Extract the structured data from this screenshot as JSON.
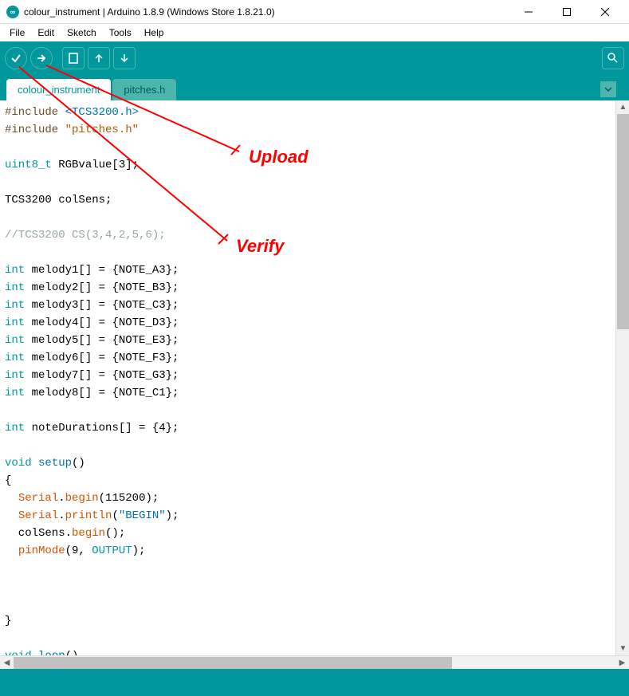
{
  "titlebar": {
    "title": "colour_instrument | Arduino 1.8.9 (Windows Store 1.8.21.0)",
    "icon_text": "∞"
  },
  "menubar": {
    "items": [
      "File",
      "Edit",
      "Sketch",
      "Tools",
      "Help"
    ]
  },
  "toolbar": {
    "verify_name": "verify",
    "upload_name": "upload",
    "new_name": "new",
    "open_name": "open",
    "save_name": "save",
    "serial_name": "serial-monitor"
  },
  "tabs": {
    "items": [
      {
        "label": "colour_instrument",
        "active": true
      },
      {
        "label": "pitches.h",
        "active": false
      }
    ]
  },
  "annotations": {
    "upload": "Upload",
    "verify": "Verify"
  },
  "code": {
    "lines": [
      {
        "t": "pp",
        "txt": "#include"
      },
      {
        "t": "sp"
      },
      {
        "t": "str",
        "txt": "<TCS3200.h>"
      },
      {
        "t": "nl"
      },
      {
        "t": "pp",
        "txt": "#include"
      },
      {
        "t": "sp"
      },
      {
        "t": "str2",
        "txt": "\"pitches.h\""
      },
      {
        "t": "nl"
      },
      {
        "t": "nl"
      },
      {
        "t": "ty",
        "txt": "uint8_t"
      },
      {
        "t": "sp"
      },
      {
        "t": "lit",
        "txt": "RGBvalue[3];"
      },
      {
        "t": "nl"
      },
      {
        "t": "nl"
      },
      {
        "t": "lit",
        "txt": "TCS3200 colSens;"
      },
      {
        "t": "nl"
      },
      {
        "t": "nl"
      },
      {
        "t": "cmt",
        "txt": "//TCS3200 CS(3,4,2,5,6);"
      },
      {
        "t": "nl"
      },
      {
        "t": "nl"
      },
      {
        "t": "ty",
        "txt": "int"
      },
      {
        "t": "sp"
      },
      {
        "t": "lit",
        "txt": "melody1[] = {NOTE_A3};"
      },
      {
        "t": "nl"
      },
      {
        "t": "ty",
        "txt": "int"
      },
      {
        "t": "sp"
      },
      {
        "t": "lit",
        "txt": "melody2[] = {NOTE_B3};"
      },
      {
        "t": "nl"
      },
      {
        "t": "ty",
        "txt": "int"
      },
      {
        "t": "sp"
      },
      {
        "t": "lit",
        "txt": "melody3[] = {NOTE_C3};"
      },
      {
        "t": "nl"
      },
      {
        "t": "ty",
        "txt": "int"
      },
      {
        "t": "sp"
      },
      {
        "t": "lit",
        "txt": "melody4[] = {NOTE_D3};"
      },
      {
        "t": "nl"
      },
      {
        "t": "ty",
        "txt": "int"
      },
      {
        "t": "sp"
      },
      {
        "t": "lit",
        "txt": "melody5[] = {NOTE_E3};"
      },
      {
        "t": "nl"
      },
      {
        "t": "ty",
        "txt": "int"
      },
      {
        "t": "sp"
      },
      {
        "t": "lit",
        "txt": "melody6[] = {NOTE_F3};"
      },
      {
        "t": "nl"
      },
      {
        "t": "ty",
        "txt": "int"
      },
      {
        "t": "sp"
      },
      {
        "t": "lit",
        "txt": "melody7[] = {NOTE_G3};"
      },
      {
        "t": "nl"
      },
      {
        "t": "ty",
        "txt": "int"
      },
      {
        "t": "sp"
      },
      {
        "t": "lit",
        "txt": "melody8[] = {NOTE_C1};"
      },
      {
        "t": "nl"
      },
      {
        "t": "nl"
      },
      {
        "t": "ty",
        "txt": "int"
      },
      {
        "t": "sp"
      },
      {
        "t": "lit",
        "txt": "noteDurations[] = {4};"
      },
      {
        "t": "nl"
      },
      {
        "t": "nl"
      },
      {
        "t": "ty",
        "txt": "void"
      },
      {
        "t": "sp"
      },
      {
        "t": "kw",
        "txt": "setup"
      },
      {
        "t": "lit",
        "txt": "()"
      },
      {
        "t": "nl"
      },
      {
        "t": "lit",
        "txt": "{"
      },
      {
        "t": "nl"
      },
      {
        "t": "lit",
        "txt": "  "
      },
      {
        "t": "fn",
        "txt": "Serial"
      },
      {
        "t": "lit",
        "txt": "."
      },
      {
        "t": "fn",
        "txt": "begin"
      },
      {
        "t": "lit",
        "txt": "(115200);"
      },
      {
        "t": "nl"
      },
      {
        "t": "lit",
        "txt": "  "
      },
      {
        "t": "fn",
        "txt": "Serial"
      },
      {
        "t": "lit",
        "txt": "."
      },
      {
        "t": "fn",
        "txt": "println"
      },
      {
        "t": "lit",
        "txt": "("
      },
      {
        "t": "str",
        "txt": "\"BEGIN\""
      },
      {
        "t": "lit",
        "txt": ");"
      },
      {
        "t": "nl"
      },
      {
        "t": "lit",
        "txt": "  colSens."
      },
      {
        "t": "fn",
        "txt": "begin"
      },
      {
        "t": "lit",
        "txt": "();"
      },
      {
        "t": "nl"
      },
      {
        "t": "lit",
        "txt": "  "
      },
      {
        "t": "fn",
        "txt": "pinMode"
      },
      {
        "t": "lit",
        "txt": "(9, "
      },
      {
        "t": "ty",
        "txt": "OUTPUT"
      },
      {
        "t": "lit",
        "txt": ");"
      },
      {
        "t": "nl"
      },
      {
        "t": "nl"
      },
      {
        "t": "nl"
      },
      {
        "t": "nl"
      },
      {
        "t": "lit",
        "txt": "}"
      },
      {
        "t": "nl"
      },
      {
        "t": "nl"
      },
      {
        "t": "ty",
        "txt": "void"
      },
      {
        "t": "sp"
      },
      {
        "t": "kw",
        "txt": "loop"
      },
      {
        "t": "lit",
        "txt": "()"
      },
      {
        "t": "nl"
      }
    ]
  }
}
